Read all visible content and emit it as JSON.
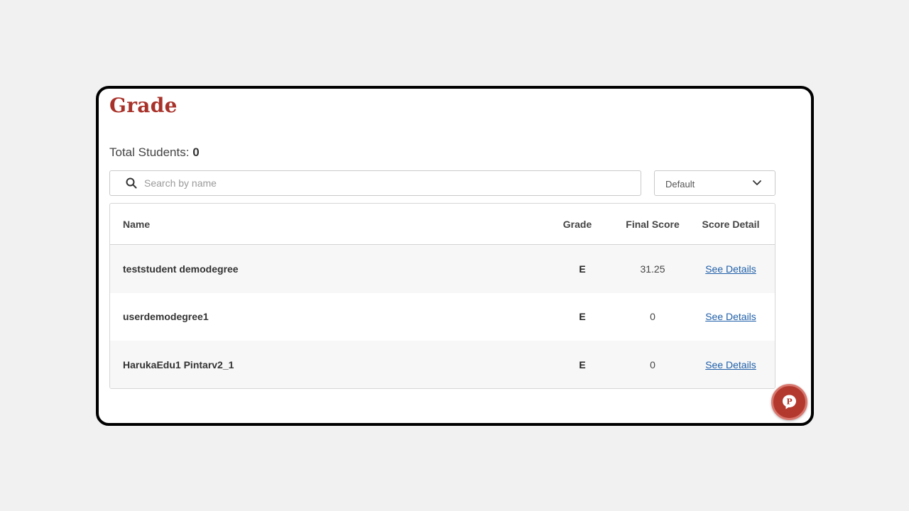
{
  "page": {
    "title": "Grade",
    "total_label": "Total Students: ",
    "total_value": "0"
  },
  "search": {
    "placeholder": "Search by name",
    "value": ""
  },
  "sort": {
    "selected": "Default"
  },
  "table": {
    "headers": {
      "name": "Name",
      "grade": "Grade",
      "final_score": "Final Score",
      "score_detail": "Score Detail"
    },
    "rows": [
      {
        "name": "teststudent demodegree",
        "grade": "E",
        "final_score": "31.25",
        "detail": "See Details"
      },
      {
        "name": "userdemodegree1",
        "grade": "E",
        "final_score": "0",
        "detail": "See Details"
      },
      {
        "name": "HarukaEdu1 Pintarv2_1",
        "grade": "E",
        "final_score": "0",
        "detail": "See Details"
      }
    ]
  },
  "fab": {
    "icon": "chat-p-icon",
    "letter": "P"
  },
  "colors": {
    "accent": "#a8322a",
    "link": "#1f5fa8",
    "fab": "#b3392f"
  }
}
